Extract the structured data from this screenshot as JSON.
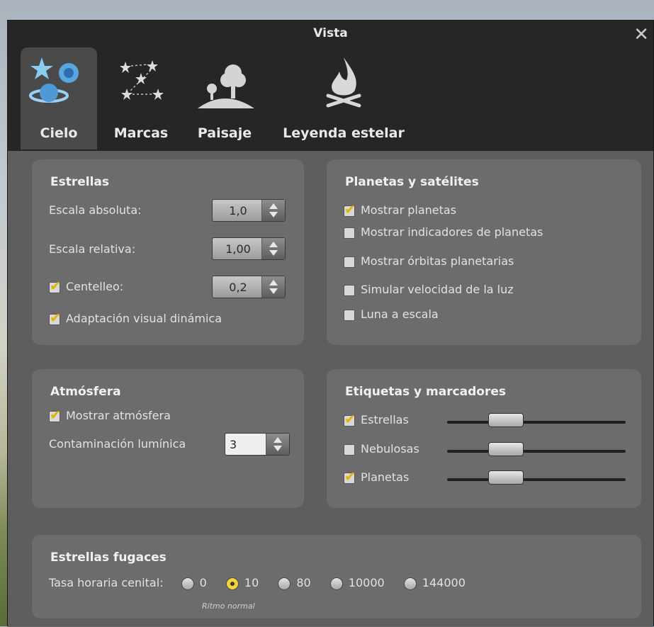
{
  "window": {
    "title": "Vista"
  },
  "tabs": [
    {
      "label": "Cielo",
      "icon": "sky-icon",
      "active": true
    },
    {
      "label": "Marcas",
      "icon": "constellation-icon",
      "active": false
    },
    {
      "label": "Paisaje",
      "icon": "tree-icon",
      "active": false
    },
    {
      "label": "Leyenda estelar",
      "icon": "campfire-icon",
      "active": false
    }
  ],
  "stars": {
    "title": "Estrellas",
    "absolute_scale": {
      "label": "Escala absoluta:",
      "value": "1,0"
    },
    "relative_scale": {
      "label": "Escala relativa:",
      "value": "1,00"
    },
    "twinkle": {
      "label": "Centelleo:",
      "value": "0,2",
      "checked": true
    },
    "dynamic_adaptation": {
      "label": "Adaptación visual dinámica",
      "checked": true
    }
  },
  "planets": {
    "title": "Planetas y satélites",
    "items": [
      {
        "label": "Mostrar planetas",
        "checked": true
      },
      {
        "label": "Mostrar indicadores de planetas",
        "checked": false
      },
      {
        "label": "Mostrar órbitas planetarias",
        "checked": false
      },
      {
        "label": "Simular velocidad de la luz",
        "checked": false
      },
      {
        "label": "Luna a escala",
        "checked": false
      }
    ]
  },
  "atmosphere": {
    "title": "Atmósfera",
    "show": {
      "label": "Mostrar atmósfera",
      "checked": true
    },
    "light_pollution": {
      "label": "Contaminación lumínica",
      "value": "3"
    }
  },
  "labels": {
    "title": "Etiquetas y marcadores",
    "items": [
      {
        "label": "Estrellas",
        "checked": true,
        "level": 0.34
      },
      {
        "label": "Nebulosas",
        "checked": false,
        "level": 0.34
      },
      {
        "label": "Planetas",
        "checked": true,
        "level": 0.34
      }
    ]
  },
  "meteors": {
    "title": "Estrellas fugaces",
    "rate_label": "Tasa horaria cenital:",
    "options": [
      "0",
      "10",
      "80",
      "10000",
      "144000"
    ],
    "selected": "10",
    "caption": "Ritmo normal"
  },
  "colors": {
    "accent": "#e2b400",
    "panel": "#6c6c6c",
    "title_bar": "#262626"
  }
}
